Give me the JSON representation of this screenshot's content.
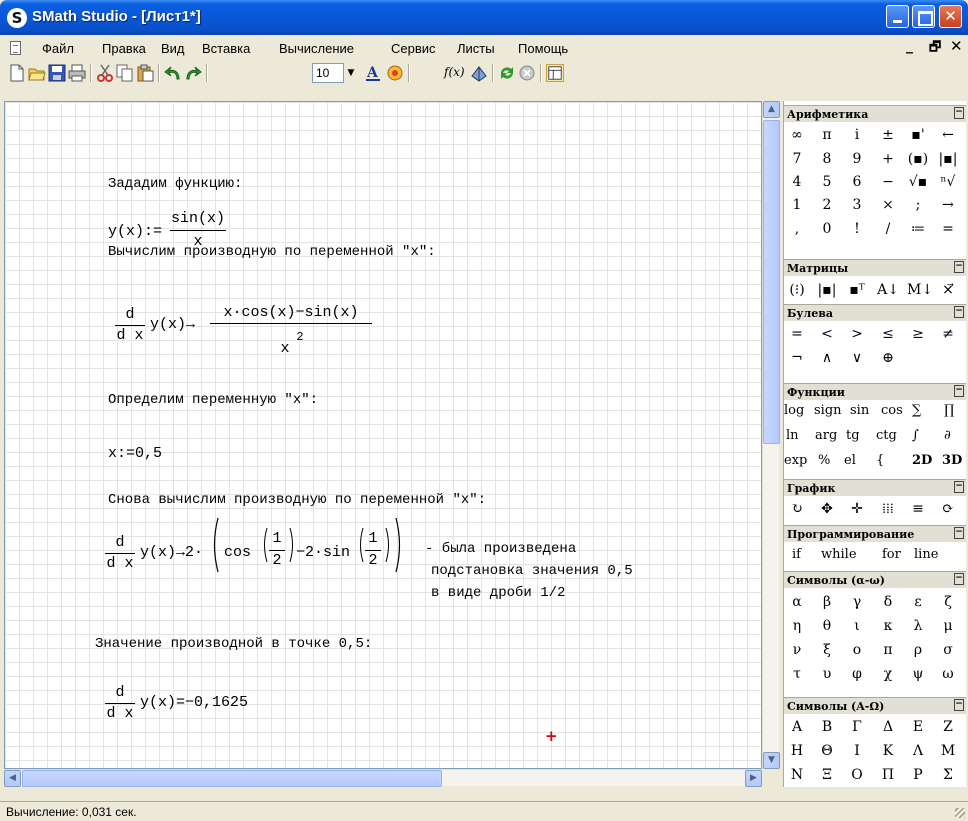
{
  "window": {
    "title": "SMath Studio - [Лист1*]",
    "app_icon_letter": "S"
  },
  "menu": {
    "items": [
      "Файл",
      "Правка",
      "Вид",
      "Вставка",
      "Вычисление",
      "Сервис",
      "Листы",
      "Помощь"
    ],
    "mdi_minimize": "_",
    "mdi_restore": "🗗",
    "mdi_close": "✕"
  },
  "toolbar": {
    "font_size": "10",
    "font_size_drop": "▼",
    "fx_label": "f(x)"
  },
  "worksheet": {
    "line1": "Зададим функцию:",
    "def_lhs": "y(x):=",
    "def_num": "sin(x)",
    "def_den": "x",
    "line2": "Вычислим производную по переменной \"x\":",
    "d_num": "d",
    "d_den": "d x",
    "der1_lhs": "y(x)→",
    "der1_num": "x·cos(x)−sin(x)",
    "der1_den": "x",
    "der1_exp": "2",
    "line3": "Определим переменную \"x\":",
    "assign": "x:=0,5",
    "line4": "Снова вычислим производную по переменной \"x\":",
    "der2_lhs": "y(x)→2·",
    "der2_cos": "cos",
    "der2_mid": "−2·sin",
    "half_num": "1",
    "half_den": "2",
    "note1": "- была произведена",
    "note2": "подстановка значения 0,5",
    "note3": "в виде дроби 1/2",
    "line5": "Значение производной в точке 0,5:",
    "der3_lhs": "y(x)=−0,1625",
    "cursor": "+"
  },
  "scroll": {
    "up": "▲",
    "down": "▼",
    "left": "◀",
    "right": "▶"
  },
  "panel": {
    "collapse_glyph": "−",
    "arith": {
      "title": "Арифметика",
      "rows": [
        [
          "∞",
          "π",
          "i",
          "±",
          "▪'",
          "←"
        ],
        [
          "7",
          "8",
          "9",
          "+",
          "(▪)",
          "|▪|"
        ],
        [
          "4",
          "5",
          "6",
          "−",
          "√▪",
          "ⁿ√"
        ],
        [
          "1",
          "2",
          "3",
          "×",
          ";",
          "→"
        ],
        [
          ",",
          "0",
          "!",
          "/",
          "≔",
          "="
        ]
      ]
    },
    "matrix": {
      "title": "Матрицы",
      "row": [
        "(⁝)",
        "|▪|",
        "▪ᵀ",
        "A↓",
        "M↓",
        "×⃗"
      ]
    },
    "bool": {
      "title": "Булева",
      "rows": [
        [
          "=",
          "<",
          ">",
          "≤",
          "≥",
          "≠"
        ],
        [
          "¬",
          "∧",
          "∨",
          "⊕"
        ]
      ]
    },
    "funcs": {
      "title": "Функции",
      "rows": [
        [
          "log",
          "sign",
          "sin",
          "cos",
          "∑",
          "∏"
        ],
        [
          "ln",
          "arg",
          "tg",
          "ctg",
          "∫",
          "∂"
        ],
        [
          "exp",
          "%",
          "el",
          "{",
          "2D",
          "3D"
        ]
      ]
    },
    "graph": {
      "title": "График",
      "row": [
        "↻",
        "✥",
        "✛",
        "⁞⁞⁞",
        "≡",
        "⟳"
      ]
    },
    "prog": {
      "title": "Программирование",
      "row": [
        "if",
        "while",
        "for",
        "line"
      ]
    },
    "greek": {
      "title": "Символы (α-ω)",
      "rows": [
        [
          "α",
          "β",
          "γ",
          "δ",
          "ε",
          "ζ"
        ],
        [
          "η",
          "θ",
          "ι",
          "κ",
          "λ",
          "μ"
        ],
        [
          "ν",
          "ξ",
          "ο",
          "π",
          "ρ",
          "σ"
        ],
        [
          "τ",
          "υ",
          "φ",
          "χ",
          "ψ",
          "ω"
        ]
      ]
    },
    "greekcap": {
      "title": "Символы (Α-Ω)",
      "rows": [
        [
          "Α",
          "Β",
          "Γ",
          "Δ",
          "Ε",
          "Ζ"
        ],
        [
          "Η",
          "Θ",
          "Ι",
          "Κ",
          "Λ",
          "Μ"
        ],
        [
          "Ν",
          "Ξ",
          "Ο",
          "Π",
          "Ρ",
          "Σ"
        ]
      ]
    }
  },
  "status": {
    "text": "Вычисление: 0,031 сек."
  }
}
